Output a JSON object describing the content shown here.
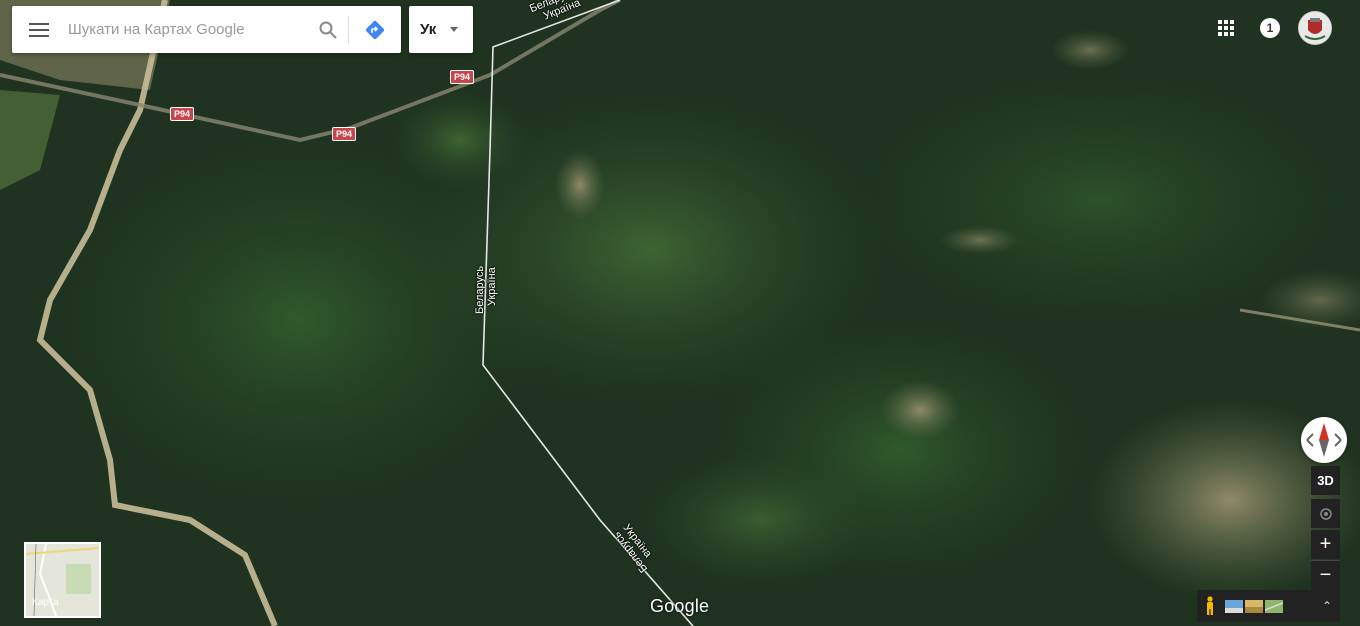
{
  "search": {
    "placeholder": "Шукати на Картах Google"
  },
  "language": {
    "label": "Ук"
  },
  "notifications": {
    "count": "1"
  },
  "minimap": {
    "label": "Карта"
  },
  "controls": {
    "three_d": "3D",
    "zoom_in": "+",
    "zoom_out": "−",
    "expand": "⌃"
  },
  "logo": {
    "text": "Google"
  },
  "roads": {
    "shield_label": "P94"
  },
  "border": {
    "north_label": "Беларусь",
    "south_label": "Україна"
  },
  "colors": {
    "forest": "#213a22",
    "border_line": "#e6e6e6",
    "road_shield": "#c8464b",
    "directions_blue": "#4285f4"
  }
}
